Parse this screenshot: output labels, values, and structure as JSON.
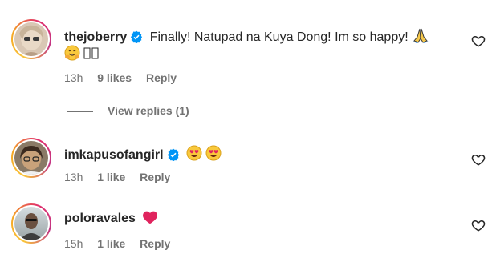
{
  "comments": [
    {
      "username": "thejoberry",
      "verified": true,
      "text": "Finally! Natupad na Kuya Dong! Im so happy!",
      "time": "13h",
      "likes": "9 likes",
      "reply_label": "Reply",
      "view_replies": "View replies (1)"
    },
    {
      "username": "imkapusofangirl",
      "verified": true,
      "text": "",
      "time": "13h",
      "likes": "1 like",
      "reply_label": "Reply"
    },
    {
      "username": "poloravales",
      "verified": false,
      "text": "",
      "time": "15h",
      "likes": "1 like",
      "reply_label": "Reply"
    }
  ],
  "colors": {
    "text": "#262626",
    "secondary": "#737373",
    "verified": "#0095f6",
    "heart": "#ed4956"
  }
}
